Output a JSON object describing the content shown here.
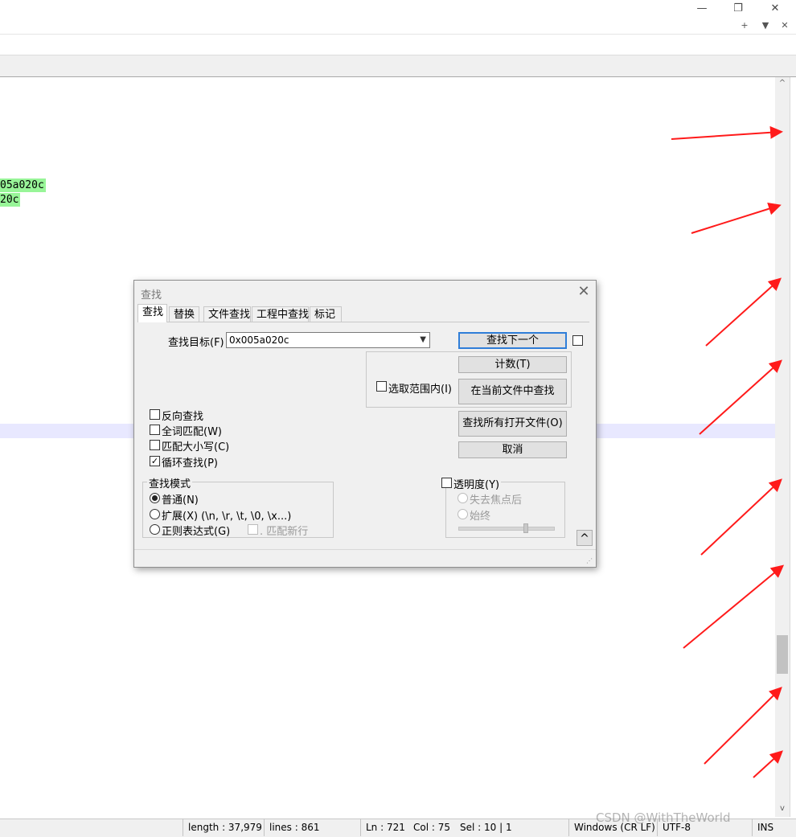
{
  "window": {
    "minimize_glyph": "—",
    "restore_glyph": "❐",
    "close_glyph": "✕",
    "tab_add_glyph": "+",
    "tab_list_glyph": "▼",
    "tab_close_glyph": "✕"
  },
  "editor": {
    "lines": [
      "05a020c",
      "20c"
    ]
  },
  "scrollbar": {
    "up_glyph": "^",
    "down_glyph": "v"
  },
  "find_dialog": {
    "title": "查找",
    "close_glyph": "✕",
    "tabs": [
      "查找",
      "替换",
      "文件查找",
      "工程中查找",
      "标记"
    ],
    "active_tab": "查找",
    "find_target_label": "查找目标(F) :",
    "find_target_value": "0x005a020c",
    "buttons": {
      "find_next": "查找下一个",
      "count": "计数(T)",
      "find_in_current": "在当前文件中查找",
      "find_in_all_open": "查找所有打开文件(O)",
      "cancel": "取消",
      "collapse": "^"
    },
    "in_selection_label": "选取范围内(I)",
    "options": [
      {
        "label": "反向查找",
        "checked": false
      },
      {
        "label": "全词匹配(W)",
        "checked": false
      },
      {
        "label": "匹配大小写(C)",
        "checked": false
      },
      {
        "label": "循环查找(P)",
        "checked": true
      }
    ],
    "search_mode": {
      "title": "查找模式",
      "modes": [
        {
          "label": "普通(N)",
          "selected": true
        },
        {
          "label": "扩展(X) (\\n, \\r, \\t, \\0, \\x...)",
          "selected": false
        },
        {
          "label": "正则表达式(G)",
          "selected": false
        }
      ],
      "dot_newline_label": ". 匹配新行"
    },
    "transparency": {
      "title": "透明度(Y)",
      "checked": false,
      "options": [
        "失去焦点后",
        "始终"
      ]
    }
  },
  "status_bar": {
    "length": "length : 37,979",
    "lines": "lines : 861",
    "ln": "Ln : 721",
    "col": "Col : 75",
    "sel": "Sel : 10 | 1",
    "eol": "Windows (CR LF)",
    "encoding": "UTF-8",
    "mode": "INS"
  },
  "watermark": "CSDN @WithTheWorld",
  "colors": {
    "highlight": "#98f598",
    "current_line": "#e8e8ff",
    "arrow": "#ff1a1a",
    "primary_button_border": "#2f7ed8"
  }
}
